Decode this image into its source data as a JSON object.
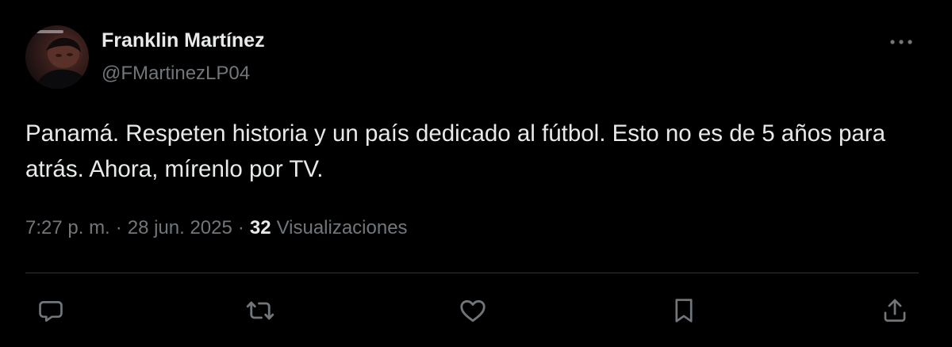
{
  "author": {
    "name": "Franklin Martínez",
    "handle": "@FMartinezLP04"
  },
  "tweet": {
    "text": "Panamá. Respeten historia y un país dedicado al fútbol. Esto no es de 5 años para atrás. Ahora, mírenlo por TV."
  },
  "meta": {
    "time": "7:27 p. m.",
    "separator": "·",
    "date": "28 jun. 2025",
    "views_count": "32",
    "views_label": "Visualizaciones"
  },
  "icons": {
    "more": "more-horizontal-icon",
    "reply": "reply-icon",
    "retweet": "retweet-icon",
    "like": "heart-icon",
    "bookmark": "bookmark-icon",
    "share": "share-icon"
  },
  "colors": {
    "background": "#000000",
    "text_primary": "#e7e9ea",
    "text_secondary": "#71767b",
    "divider": "#2f3336"
  }
}
